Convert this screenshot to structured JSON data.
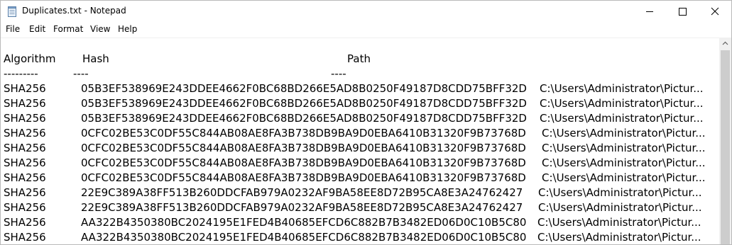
{
  "window": {
    "title": "Duplicates.txt - Notepad"
  },
  "titlebar": {
    "app_icon": "notepad-icon",
    "buttons": {
      "minimize_icon": "minimize-icon",
      "maximize_icon": "maximize-icon",
      "close_icon": "close-icon"
    }
  },
  "menu": {
    "items": [
      "File",
      "Edit",
      "Format",
      "View",
      "Help"
    ]
  },
  "editor": {
    "header": {
      "algorithm": "Algorithm",
      "hash": "Hash",
      "path": "Path"
    },
    "underline": {
      "algorithm": "---------",
      "hash": "----",
      "path": "----"
    },
    "rows": [
      {
        "algorithm": "SHA256",
        "hash": "05B3EF538969E243DDEE4662F0BC68BD266E5AD8B0250F49187D8CDD75BFF32D",
        "path": "C:\\Users\\Administrator\\Pictur..."
      },
      {
        "algorithm": "SHA256",
        "hash": "05B3EF538969E243DDEE4662F0BC68BD266E5AD8B0250F49187D8CDD75BFF32D",
        "path": "C:\\Users\\Administrator\\Pictur..."
      },
      {
        "algorithm": "SHA256",
        "hash": "05B3EF538969E243DDEE4662F0BC68BD266E5AD8B0250F49187D8CDD75BFF32D",
        "path": "C:\\Users\\Administrator\\Pictur..."
      },
      {
        "algorithm": "SHA256",
        "hash": "0CFC02BE53C0DF55C844AB08AE8FA3B738DB9BA9D0EBA6410B31320F9B73768D",
        "path": "C:\\Users\\Administrator\\Pictur..."
      },
      {
        "algorithm": "SHA256",
        "hash": "0CFC02BE53C0DF55C844AB08AE8FA3B738DB9BA9D0EBA6410B31320F9B73768D",
        "path": "C:\\Users\\Administrator\\Pictur..."
      },
      {
        "algorithm": "SHA256",
        "hash": "0CFC02BE53C0DF55C844AB08AE8FA3B738DB9BA9D0EBA6410B31320F9B73768D",
        "path": "C:\\Users\\Administrator\\Pictur..."
      },
      {
        "algorithm": "SHA256",
        "hash": "0CFC02BE53C0DF55C844AB08AE8FA3B738DB9BA9D0EBA6410B31320F9B73768D",
        "path": "C:\\Users\\Administrator\\Pictur..."
      },
      {
        "algorithm": "SHA256",
        "hash": "22E9C389A38FF513B260DDCFAB979A0232AF9BA58EE8D72B95CA8E3A24762427",
        "path": "C:\\Users\\Administrator\\Pictur..."
      },
      {
        "algorithm": "SHA256",
        "hash": "22E9C389A38FF513B260DDCFAB979A0232AF9BA58EE8D72B95CA8E3A24762427",
        "path": "C:\\Users\\Administrator\\Pictur..."
      },
      {
        "algorithm": "SHA256",
        "hash": "AA322B4350380BC2024195E1FED4B40685EFCD6C882B7B3482ED06D0C10B5C80",
        "path": "C:\\Users\\Administrator\\Pictur..."
      },
      {
        "algorithm": "SHA256",
        "hash": "AA322B4350380BC2024195E1FED4B40685EFCD6C882B7B3482ED06D0C10B5C80",
        "path": "C:\\Users\\Administrator\\Pictur..."
      }
    ]
  },
  "scrollbar": {
    "up_icon": "scroll-up-arrow-icon"
  }
}
